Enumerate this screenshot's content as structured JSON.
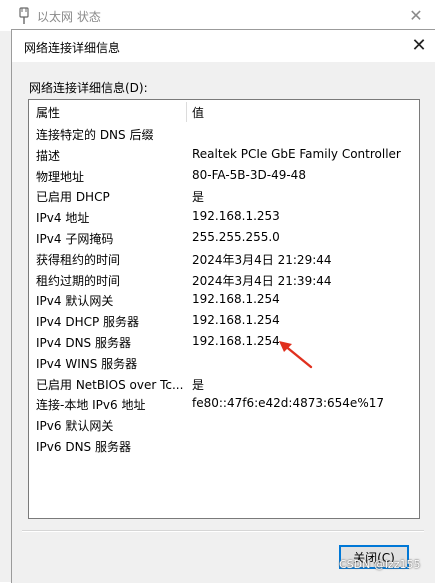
{
  "parent_window": {
    "title": "以太网 状态",
    "close_glyph": "✕",
    "icon": "network-plug-icon"
  },
  "dialog": {
    "title": "网络连接详细信息",
    "close_glyph": "✕",
    "details_label": "网络连接详细信息(D):",
    "columns": {
      "property": "属性",
      "value": "值"
    },
    "rows": [
      {
        "key": "连接特定的 DNS 后缀",
        "value": ""
      },
      {
        "key": "描述",
        "value": "Realtek PCIe GbE Family Controller"
      },
      {
        "key": "物理地址",
        "value": "80-FA-5B-3D-49-48"
      },
      {
        "key": "已启用 DHCP",
        "value": "是"
      },
      {
        "key": "IPv4 地址",
        "value": "192.168.1.253"
      },
      {
        "key": "IPv4 子网掩码",
        "value": "255.255.255.0"
      },
      {
        "key": "获得租约的时间",
        "value": "2024年3月4日 21:29:44"
      },
      {
        "key": "租约过期的时间",
        "value": "2024年3月4日 21:39:44"
      },
      {
        "key": "IPv4 默认网关",
        "value": "192.168.1.254"
      },
      {
        "key": "IPv4 DHCP 服务器",
        "value": "192.168.1.254"
      },
      {
        "key": "IPv4 DNS 服务器",
        "value": "192.168.1.254"
      },
      {
        "key": "IPv4 WINS 服务器",
        "value": ""
      },
      {
        "key": "已启用 NetBIOS over Tc...",
        "value": "是"
      },
      {
        "key": "连接-本地 IPv6 地址",
        "value": "fe80::47f6:e42d:4873:654e%17"
      },
      {
        "key": "IPv6 默认网关",
        "value": ""
      },
      {
        "key": "IPv6 DNS 服务器",
        "value": ""
      }
    ],
    "close_button": "关闭(C)"
  },
  "watermark": "CSDN @lzz155",
  "annotation": {
    "icon": "red-arrow-icon",
    "color": "#e0301e"
  }
}
